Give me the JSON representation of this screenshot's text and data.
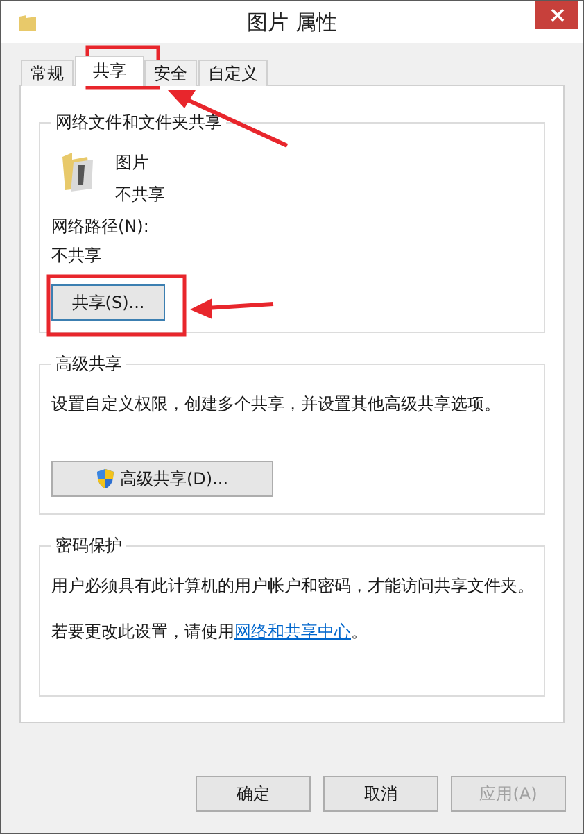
{
  "window": {
    "title": "图片 属性"
  },
  "tabs": [
    {
      "label": "常规",
      "selected": false
    },
    {
      "label": "共享",
      "selected": true
    },
    {
      "label": "安全",
      "selected": false
    },
    {
      "label": "自定义",
      "selected": false
    }
  ],
  "network_sharing": {
    "heading": "网络文件和文件夹共享",
    "item_name": "图片",
    "item_status": "不共享",
    "path_label": "网络路径(N):",
    "path_value": "不共享",
    "share_button": "共享(S)..."
  },
  "advanced_sharing": {
    "heading": "高级共享",
    "description": "设置自定义权限，创建多个共享，并设置其他高级共享选项。",
    "button": "高级共享(D)..."
  },
  "password_protection": {
    "heading": "密码保护",
    "description": "用户必须具有此计算机的用户帐户和密码，才能访问共享文件夹。",
    "note": "若要更改此设置，请使用",
    "link": "网络和共享中心",
    "note_end": "。"
  },
  "buttons": [
    {
      "label": "确定",
      "disabled": false
    },
    {
      "label": "取消",
      "disabled": false
    },
    {
      "label": "应用(A)",
      "disabled": true
    }
  ]
}
